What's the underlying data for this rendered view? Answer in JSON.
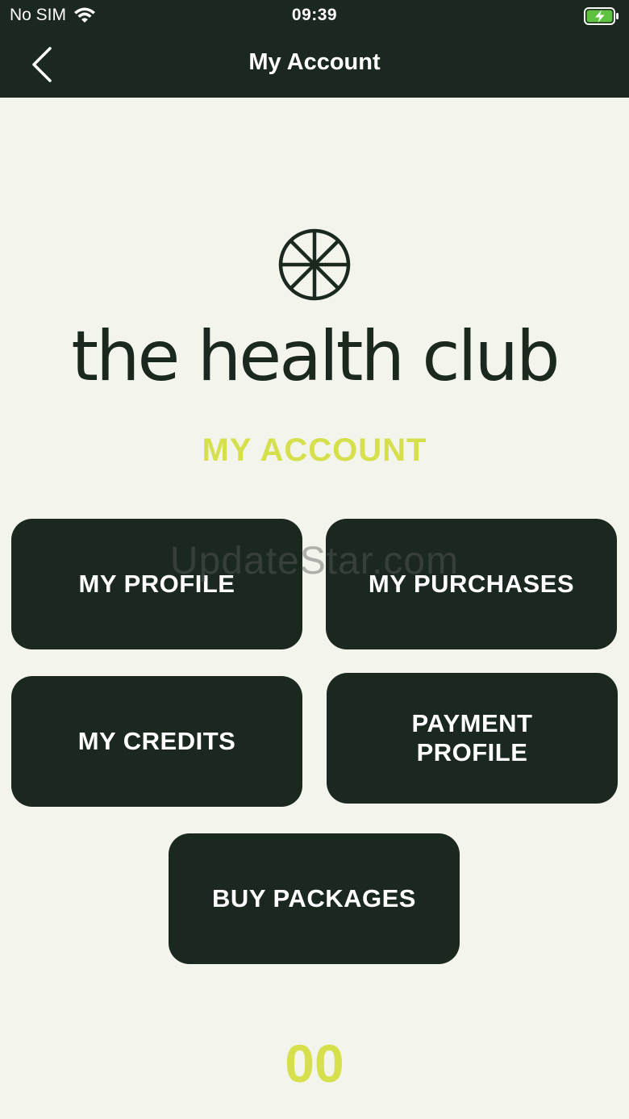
{
  "status_bar": {
    "carrier": "No SIM",
    "time": "09:39",
    "wifi_icon": "wifi-icon",
    "battery_icon": "battery-charging-icon"
  },
  "nav": {
    "back_icon": "chevron-left-icon",
    "title": "My Account"
  },
  "brand": {
    "logo_icon": "asterisk-circle-logo",
    "name": "the health club"
  },
  "section_heading": "MY ACCOUNT",
  "menu": {
    "my_profile": "MY PROFILE",
    "my_purchases": "MY PURCHASES",
    "my_credits": "MY CREDITS",
    "payment_profile_line1": "PAYMENT",
    "payment_profile_line2": "PROFILE",
    "buy_packages": "BUY PACKAGES"
  },
  "watermark": "UpdateStar.com",
  "footer": {
    "counter": "00"
  },
  "colors": {
    "dark_green": "#1b281f",
    "accent_lime": "#d5e04c",
    "background": "#f3f5ec",
    "battery_green": "#5ec13f"
  }
}
